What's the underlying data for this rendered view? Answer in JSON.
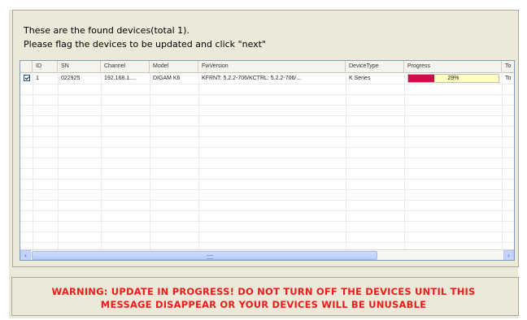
{
  "intro": {
    "line1": "These are the found devices(total 1).",
    "line2": "Please flag the devices to be updated and click \"next\""
  },
  "table": {
    "columns": [
      "",
      "ID",
      "SN",
      "Channel",
      "Model",
      "FwVersion",
      "DeviceType",
      "Progress",
      "To"
    ],
    "rows": [
      {
        "checked": true,
        "id": "1",
        "sn": "022925",
        "channel": "192.168.1....",
        "model": "DIGAM K6",
        "fw": "KFRNT: 5.2.2-706/KCTRL: 5.2.2-706/...",
        "device_type": "K Series",
        "progress_label": "29%",
        "progress": 0.29,
        "to": "To"
      }
    ]
  },
  "scrollbar": {
    "left_arrow": "‹",
    "right_arrow": "›"
  },
  "warning": {
    "line1": "WARNING: UPDATE IN PROGRESS! DO NOT TURN OFF THE DEVICES UNTIL THIS",
    "line2": "MESSAGE DISAPPEAR OR YOUR DEVICES WILL BE  UNUSABLE"
  },
  "colors": {
    "progress_fill": "#c8104a",
    "progress_bg": "#ffffc0",
    "warning_text": "#ee1c1c"
  }
}
